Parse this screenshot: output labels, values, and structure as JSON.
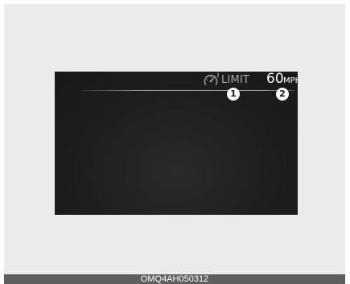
{
  "display": {
    "limit_label": "LIMIT",
    "speed_value": "60",
    "speed_unit": "MPH",
    "icon": "speed-limit-gauge-icon"
  },
  "callouts": [
    {
      "number": "1"
    },
    {
      "number": "2"
    }
  ],
  "caption": {
    "code": "OMQ4AH050312"
  },
  "colors": {
    "screen_background": "#1e1e1e",
    "frame_background": "#ebebeb",
    "caption_bar": "#5e5e5e",
    "label_gray": "#a8a8a8",
    "value_white": "#ffffff"
  }
}
